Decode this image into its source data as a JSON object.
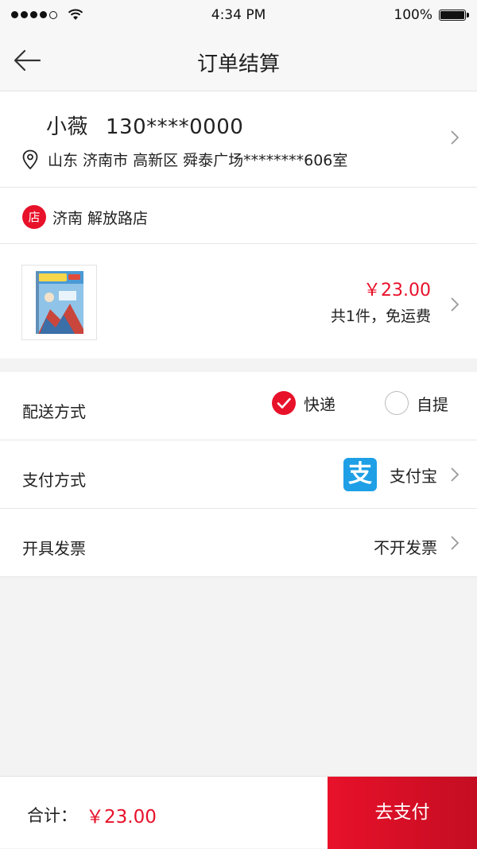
{
  "status_bar": {
    "time": "4:34 PM",
    "battery": "100%"
  },
  "nav": {
    "title": "订单结算",
    "back_icon": "arrow-left-icon"
  },
  "address": {
    "name": "小薇",
    "phone": "130****0000",
    "detail": "山东 济南市 高新区 舜泰广场********606室"
  },
  "shop": {
    "badge": "店",
    "name": "济南 解放路店"
  },
  "product": {
    "price": "￥23.00",
    "summary": "共1件，免运费"
  },
  "delivery": {
    "label": "配送方式",
    "options": [
      {
        "label": "快递",
        "selected": true
      },
      {
        "label": "自提",
        "selected": false
      }
    ]
  },
  "payment": {
    "label": "支付方式",
    "method": "支付宝",
    "icon": "alipay-icon"
  },
  "invoice": {
    "label": "开具发票",
    "value": "不开发票"
  },
  "footer": {
    "total_label": "合计：",
    "total_value": "￥23.00",
    "pay_button": "去支付"
  },
  "colors": {
    "accent": "#e8112a",
    "alipay": "#1e9fe6"
  }
}
